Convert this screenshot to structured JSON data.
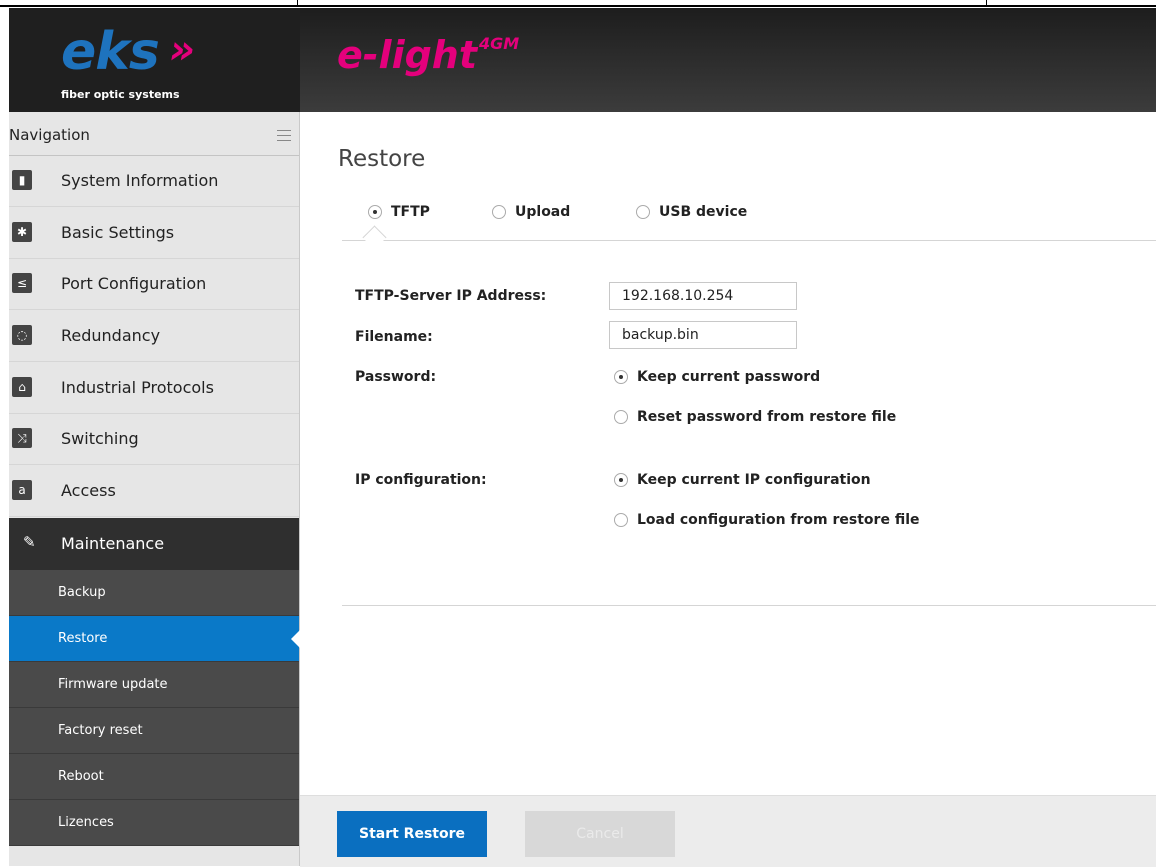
{
  "header": {
    "brand": "eks",
    "brand_arrows": "»",
    "brand_tagline": "fiber optic systems",
    "product": "e-light",
    "product_sup": "4GM",
    "brand_color": "#1e73be",
    "accent_color": "#e4007c"
  },
  "sidebar": {
    "title": "Navigation",
    "items": [
      {
        "label": "System Information",
        "icon": "chart-icon"
      },
      {
        "label": "Basic Settings",
        "icon": "gear-icon"
      },
      {
        "label": "Port Configuration",
        "icon": "port-icon"
      },
      {
        "label": "Redundancy",
        "icon": "ring-icon"
      },
      {
        "label": "Industrial Protocols",
        "icon": "factory-icon"
      },
      {
        "label": "Switching",
        "icon": "shuffle-icon"
      },
      {
        "label": "Access",
        "icon": "lock-icon"
      }
    ],
    "maintenance": {
      "label": "Maintenance",
      "icon": "wrench-icon",
      "subitems": [
        "Backup",
        "Restore",
        "Firmware update",
        "Factory reset",
        "Reboot",
        "Lizences"
      ],
      "active": "Restore"
    }
  },
  "main": {
    "title": "Restore",
    "tabs": [
      {
        "label": "TFTP",
        "selected": true
      },
      {
        "label": "Upload",
        "selected": false
      },
      {
        "label": "USB device",
        "selected": false
      }
    ],
    "form": {
      "server_label": "TFTP-Server IP Address:",
      "server_value": "192.168.10.254",
      "filename_label": "Filename:",
      "filename_value": "backup.bin",
      "password_label": "Password:",
      "password_options": [
        "Keep current password",
        "Reset password from restore file"
      ],
      "ip_label": "IP configuration:",
      "ip_options": [
        "Keep current IP configuration",
        "Load configuration from restore file"
      ]
    },
    "buttons": {
      "start": "Start Restore",
      "cancel": "Cancel"
    }
  }
}
